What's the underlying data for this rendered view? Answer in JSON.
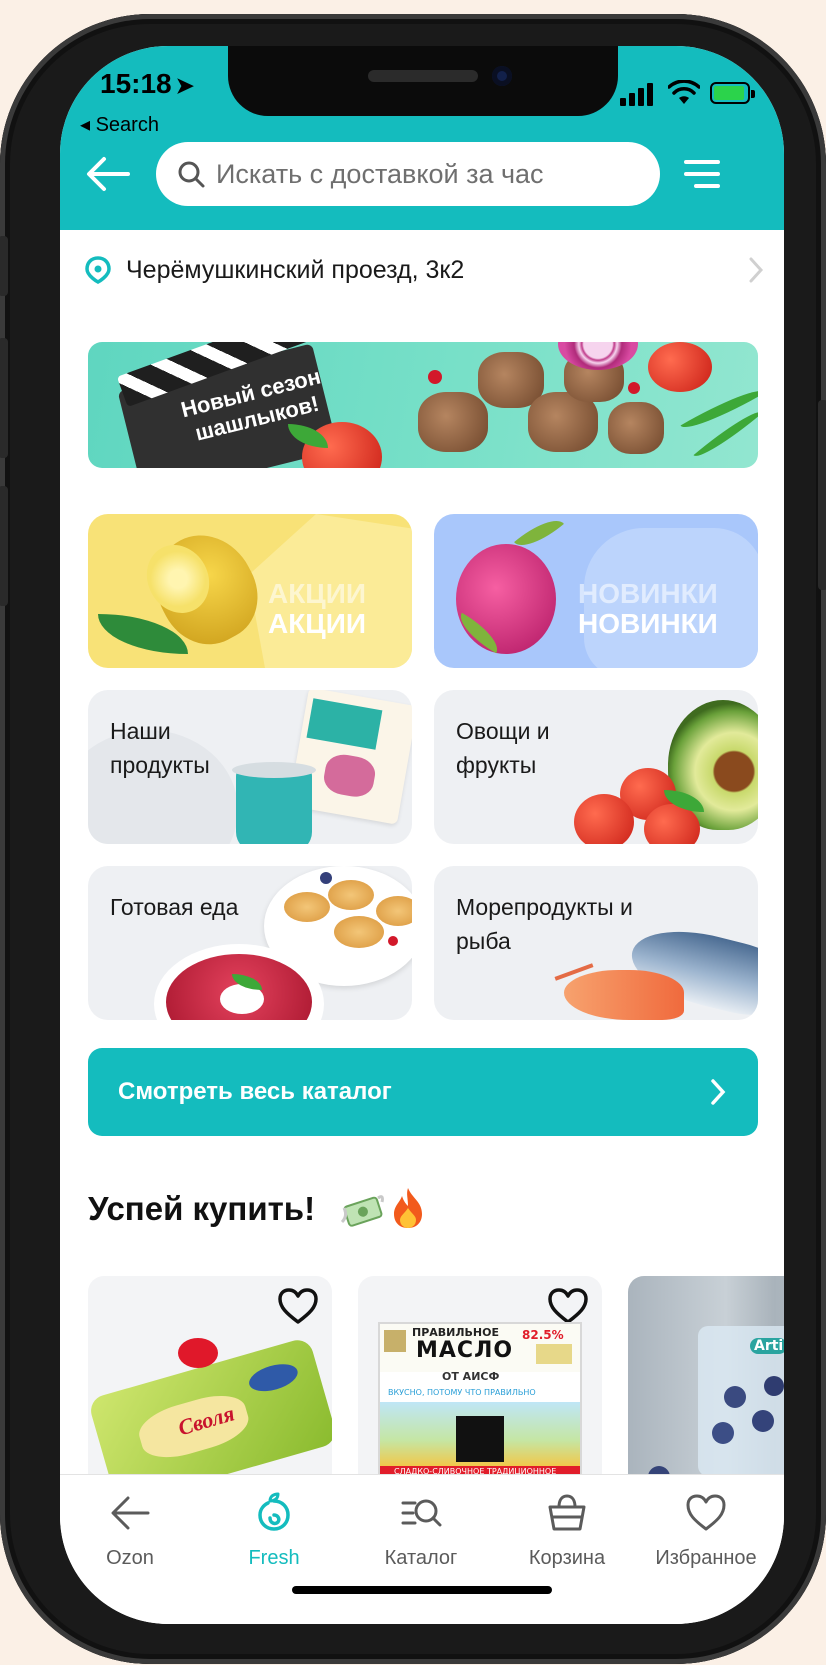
{
  "status_bar": {
    "time": "15:18",
    "back_app": "◂ Search"
  },
  "header": {
    "search_placeholder": "Искать с доставкой за час"
  },
  "address": {
    "text": "Черёмушкинский проезд, 3к2"
  },
  "banner": {
    "title_line1": "Новый сезон",
    "title_line2": "шашлыков!"
  },
  "promo_tiles": [
    {
      "label": "АКЦИИ"
    },
    {
      "label": "НОВИНКИ"
    }
  ],
  "category_tiles": [
    {
      "line1": "Наши",
      "line2": "продукты"
    },
    {
      "line1": "Овощи и",
      "line2": "фрукты"
    },
    {
      "line1": "Готовая еда",
      "line2": ""
    },
    {
      "line1": "Морепродукты и",
      "line2": "рыба"
    }
  ],
  "catalog_button": {
    "label": "Смотреть весь каталог"
  },
  "section": {
    "title": "Успей купить!"
  },
  "products": [
    {
      "brand_text": "Своля"
    },
    {
      "brand_line1": "ПРАВИЛЬНОЕ",
      "brand_line2": "МАСЛО",
      "brand_sub": "ОТ АИСФ",
      "fat": "82.5%",
      "tagline": "ВКУСНО, ПОТОМУ ЧТО ПРАВИЛЬНО",
      "bottom": "СЛАДКО-СЛИВОЧНОЕ ТРАДИЦИОННОЕ"
    },
    {
      "brand_text": "Arti"
    }
  ],
  "tabbar": {
    "items": [
      {
        "label": "Ozon",
        "icon": "arrow-left-icon"
      },
      {
        "label": "Fresh",
        "icon": "fresh-logo-icon"
      },
      {
        "label": "Каталог",
        "icon": "catalog-search-icon"
      },
      {
        "label": "Корзина",
        "icon": "basket-icon"
      },
      {
        "label": "Избранное",
        "icon": "heart-icon"
      }
    ],
    "active_index": 1
  },
  "colors": {
    "accent": "#14bcbe",
    "promo_yellow": "#f8e277",
    "promo_blue": "#a9c7fb",
    "tile_gray": "#eef0f3"
  }
}
